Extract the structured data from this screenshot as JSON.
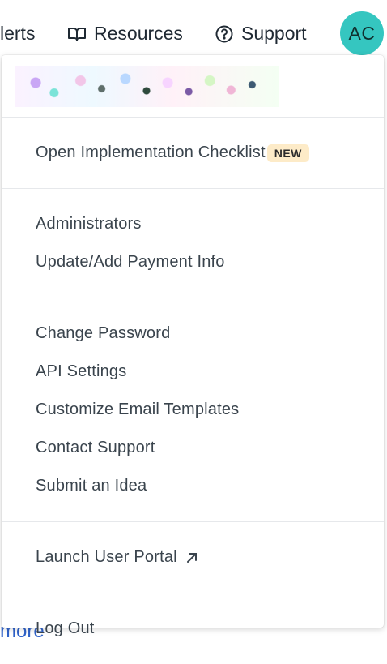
{
  "topnav": {
    "alerts_label": "lerts",
    "resources_label": "Resources",
    "support_label": "Support",
    "avatar_initials": "AC",
    "avatar_color": "#35c6c0"
  },
  "menu": {
    "checklist_label": "Open Implementation Checklist",
    "new_badge": "NEW",
    "administrators_label": "Administrators",
    "payment_label": "Update/Add Payment Info",
    "change_password_label": "Change Password",
    "api_settings_label": "API Settings",
    "email_templates_label": "Customize Email Templates",
    "contact_support_label": "Contact Support",
    "submit_idea_label": "Submit an Idea",
    "user_portal_label": "Launch User Portal",
    "logout_label": "Log Out"
  },
  "background": {
    "partial_text": "more"
  }
}
